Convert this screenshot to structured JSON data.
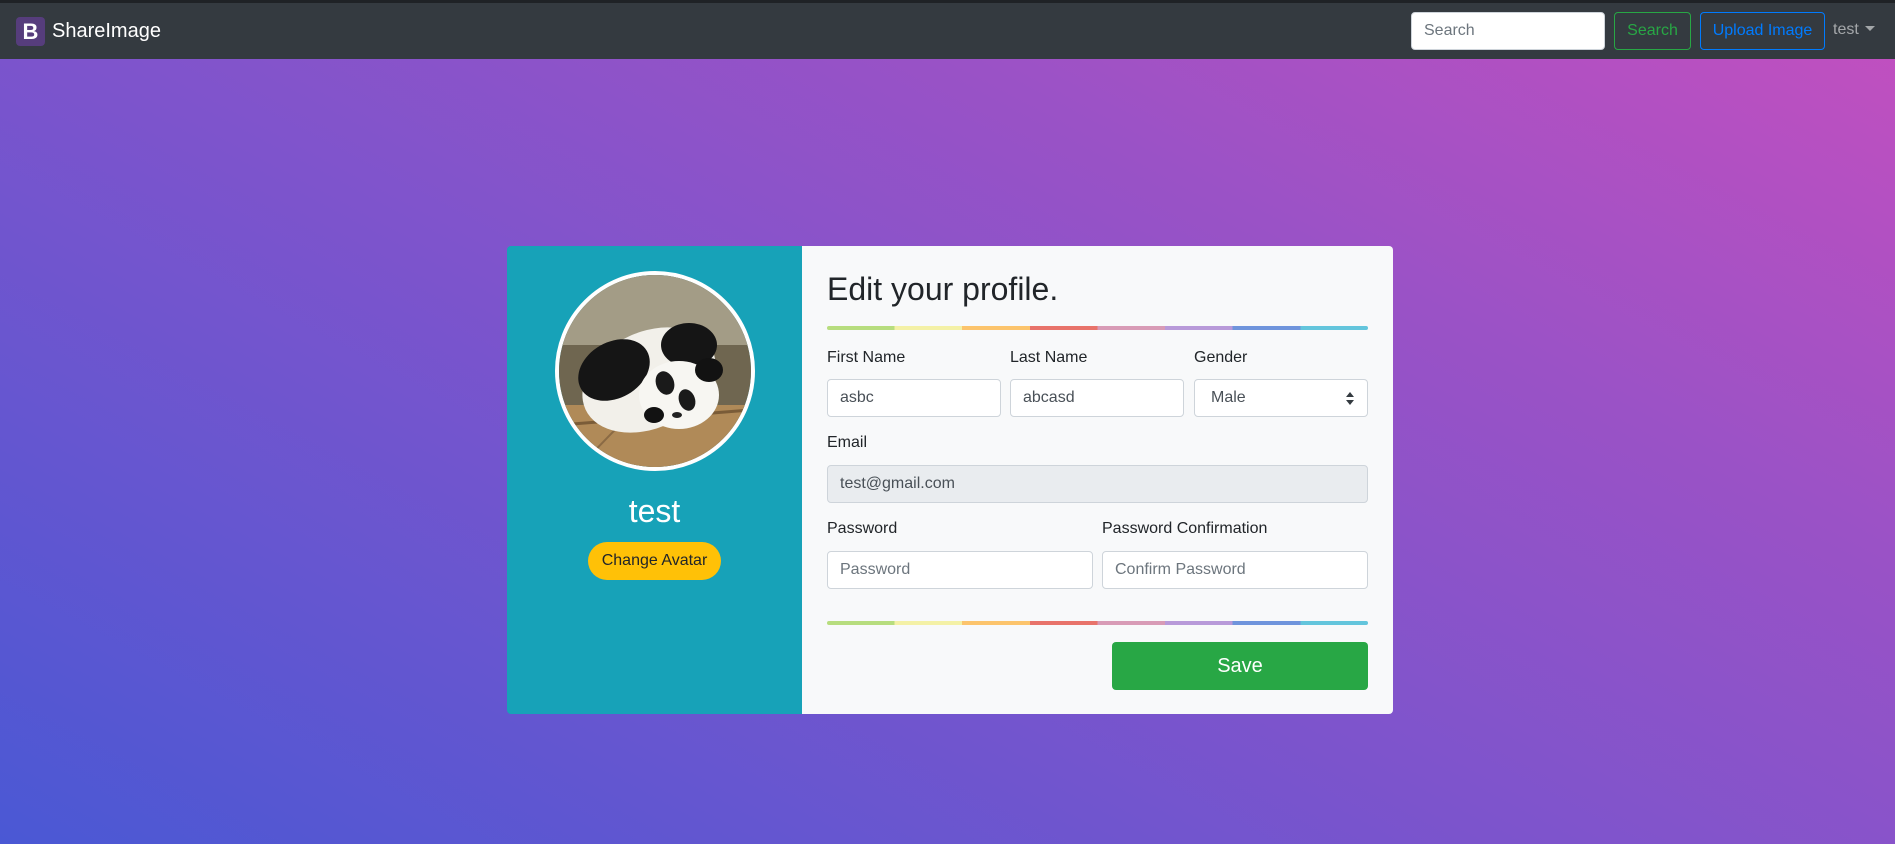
{
  "navbar": {
    "brand_icon": "B",
    "brand": "ShareImage",
    "search_placeholder": "Search",
    "search_button": "Search",
    "upload_button": "Upload Image",
    "user_menu": "test"
  },
  "profile": {
    "username": "test",
    "change_avatar": "Change Avatar",
    "avatar_alt": "panda-avatar"
  },
  "form": {
    "title": "Edit your profile.",
    "first_name_label": "First Name",
    "first_name_value": "asbc",
    "last_name_label": "Last Name",
    "last_name_value": "abcasd",
    "gender_label": "Gender",
    "gender_value": "Male",
    "email_label": "Email",
    "email_value": "test@gmail.com",
    "password_label": "Password",
    "password_placeholder": "Password",
    "confirm_label": "Password Confirmation",
    "confirm_placeholder": "Confirm Password",
    "save_button": "Save"
  },
  "colors": {
    "navbar": "#343a40",
    "left_panel": "#17a2b8",
    "avatar_button": "#ffc107",
    "save_button": "#28a745",
    "search_button": "#28a745",
    "upload_button": "#007bff"
  }
}
